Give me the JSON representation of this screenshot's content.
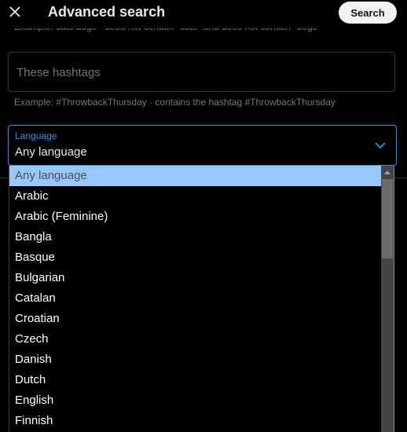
{
  "header": {
    "title": "Advanced search",
    "search_label": "Search",
    "close_icon": "close-icon"
  },
  "cut_hint": "Example: cats dogs · does not contain \"cats\" and does not contain \"dogs\"",
  "hashtags": {
    "placeholder": "These hashtags",
    "value": "",
    "hint": "Example: #ThrowbackThursday · contains the hashtag #ThrowbackThursday"
  },
  "language": {
    "label": "Language",
    "value": "Any language",
    "chevron_icon": "chevron-down-icon",
    "accent_color": "#1d9bf0",
    "options": [
      {
        "label": "Any language",
        "selected": true
      },
      {
        "label": "Arabic"
      },
      {
        "label": "Arabic (Feminine)"
      },
      {
        "label": "Bangla"
      },
      {
        "label": "Basque"
      },
      {
        "label": "Bulgarian"
      },
      {
        "label": "Catalan"
      },
      {
        "label": "Croatian"
      },
      {
        "label": "Czech"
      },
      {
        "label": "Danish"
      },
      {
        "label": "Dutch"
      },
      {
        "label": "English"
      },
      {
        "label": "Finnish"
      }
    ]
  }
}
